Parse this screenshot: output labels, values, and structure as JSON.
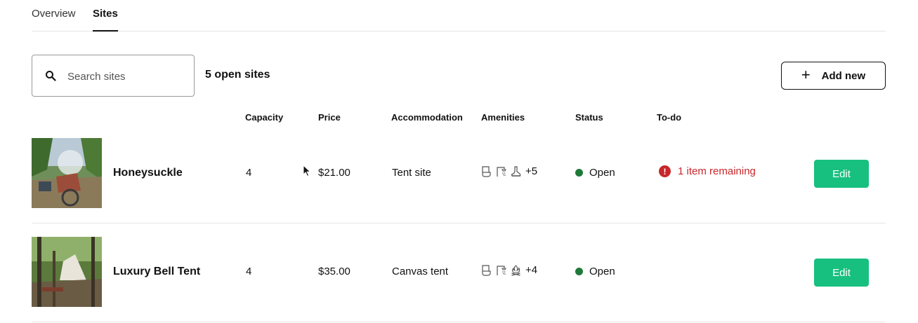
{
  "tabs": [
    {
      "label": "Overview",
      "active": false
    },
    {
      "label": "Sites",
      "active": true
    }
  ],
  "search": {
    "placeholder": "Search sites",
    "value": ""
  },
  "summary": {
    "open_sites": "5 open sites"
  },
  "toolbar": {
    "add_label": "Add new"
  },
  "columns": {
    "capacity": "Capacity",
    "price": "Price",
    "accommodation": "Accommodation",
    "amenities": "Amenities",
    "status": "Status",
    "todo": "To-do"
  },
  "sites": [
    {
      "name": "Honeysuckle",
      "capacity": "4",
      "price": "$21.00",
      "accommodation": "Tent site",
      "amenity_icons": [
        "toilet-icon",
        "shower-icon",
        "hiking-boot-icon"
      ],
      "amenities_more": "+5",
      "status": "Open",
      "todo": "1 item remaining",
      "edit_label": "Edit"
    },
    {
      "name": "Luxury Bell Tent",
      "capacity": "4",
      "price": "$35.00",
      "accommodation": "Canvas tent",
      "amenity_icons": [
        "toilet-icon",
        "shower-icon",
        "campfire-icon"
      ],
      "amenities_more": "+4",
      "status": "Open",
      "todo": "",
      "edit_label": "Edit"
    }
  ],
  "colors": {
    "accent_green": "#17c07f",
    "status_open": "#1f7a3a",
    "todo_red": "#c8262a"
  }
}
